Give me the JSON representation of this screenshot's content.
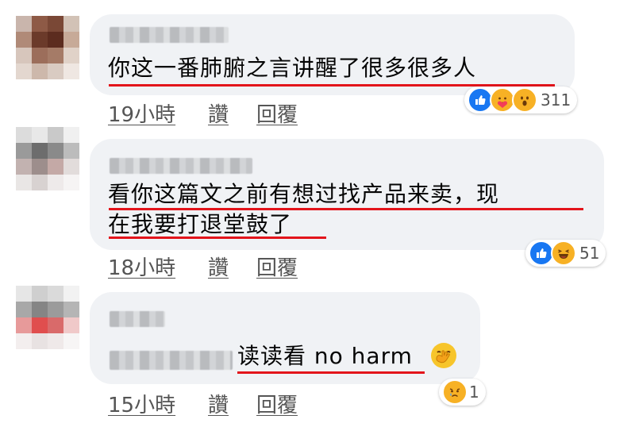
{
  "comments": [
    {
      "text_lines": [
        "你这一番肺腑之言讲醒了很多很多人"
      ],
      "time": "19小時",
      "like_label": "讚",
      "reply_label": "回覆",
      "reaction_icons": [
        "like-icon",
        "care-icon",
        "wow-icon"
      ],
      "reaction_count": "311",
      "avatar_colors": [
        "#c9b5ac",
        "#8e5a46",
        "#7a4836",
        "#d2c2b6",
        "#b08a78",
        "#6b3a2a",
        "#5c2c1f",
        "#c7aa98",
        "#d7c6bc",
        "#9c6e5b",
        "#a57b67",
        "#e0d2c8",
        "#e3d7cf",
        "#cdb8ab",
        "#d9cbc2",
        "#efe7e2"
      ]
    },
    {
      "text_lines": [
        "看你这篇文之前有想过找产品来卖，现",
        "在我要打退堂鼓了"
      ],
      "time": "18小時",
      "like_label": "讚",
      "reply_label": "回覆",
      "reaction_icons": [
        "like-icon",
        "haha-icon"
      ],
      "reaction_count": "51",
      "avatar_colors": [
        "#dcdcdc",
        "#e8e8e8",
        "#c9c9c9",
        "#f0f0f0",
        "#9a9a9a",
        "#6d6d6d",
        "#8a8a8a",
        "#bcbcbc",
        "#c2b2b0",
        "#9d8e8c",
        "#c4a9a6",
        "#e2dcdb",
        "#e9e6e5",
        "#d8d2d1",
        "#eeeaea",
        "#f6f4f4"
      ]
    },
    {
      "text_lines": [
        "读读看 no harm"
      ],
      "time": "15小時",
      "like_label": "讚",
      "reply_label": "回覆",
      "reaction_icons": [
        "sad-icon"
      ],
      "reaction_count": "1",
      "inline_emoji": "hand-over-mouth-emoji-icon",
      "avatar_colors": [
        "#e6e6e6",
        "#cfcfcf",
        "#dadada",
        "#f2f2f2",
        "#a8a8a8",
        "#858585",
        "#9b9b9b",
        "#b5b5b5",
        "#e79a9a",
        "#e04e4e",
        "#d96a6a",
        "#f0c9c9",
        "#f3eeee",
        "#e8e2e2",
        "#efe9e9",
        "#f7f5f5"
      ]
    }
  ]
}
